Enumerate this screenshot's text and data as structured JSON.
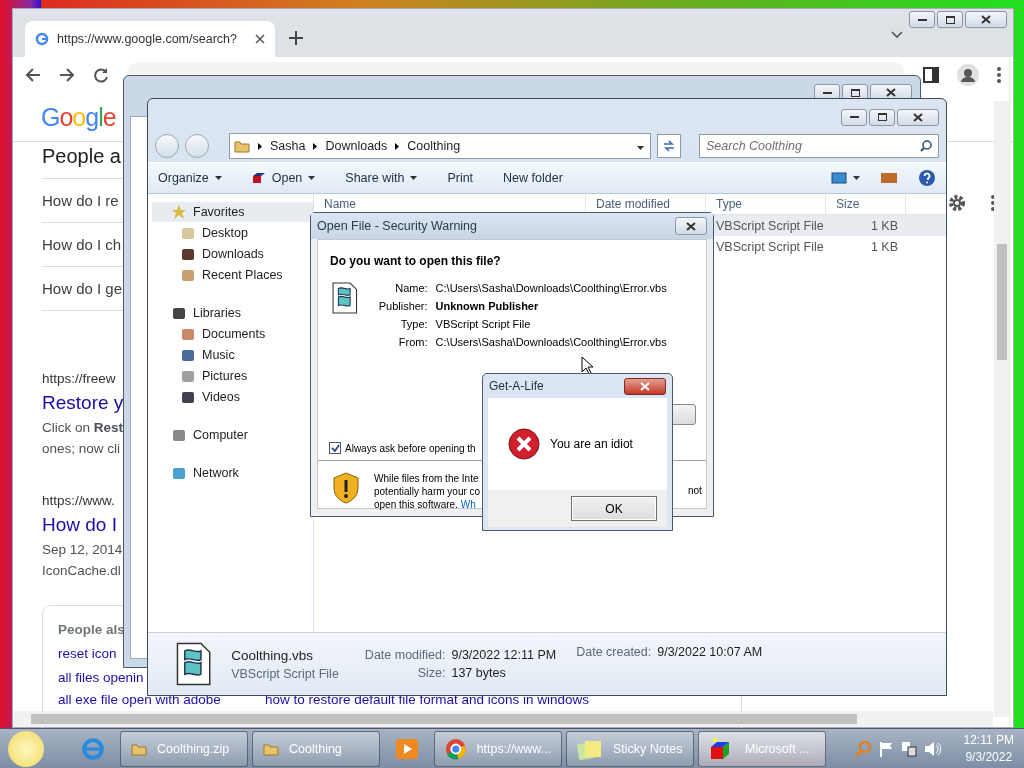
{
  "browser": {
    "tab": {
      "title": "https://www.google.com/search?"
    },
    "page": {
      "logo": "Google",
      "people_also_ask": {
        "heading": "People a",
        "questions": [
          "How do I re",
          "How do I ch",
          "How do I ge"
        ]
      },
      "results": [
        {
          "url": "https://freew",
          "title": "Restore y",
          "snippet": [
            "Click on **Rest**",
            "ones; now cli"
          ]
        },
        {
          "url": "https://www.",
          "title": "How do I",
          "snippet": [
            "Sep 12, 2014",
            "IconCache.dl"
          ]
        }
      ],
      "related": {
        "heading": "People als",
        "items": [
          "reset icon",
          "all files openin"
        ],
        "last_row": [
          "all exe file open with adobe",
          "how to restore default file format and icons in windows"
        ]
      }
    }
  },
  "explorer": {
    "breadcrumb": [
      "Sasha",
      "Downloads",
      "Coolthing"
    ],
    "search": {
      "placeholder": "Search Coolthing"
    },
    "toolbar": [
      {
        "label": "Organize",
        "dropdown": true
      },
      {
        "label": "Open",
        "dropdown": true
      },
      {
        "label": "Share with",
        "dropdown": true
      },
      {
        "label": "Print",
        "dropdown": false
      },
      {
        "label": "New folder",
        "dropdown": false
      }
    ],
    "nav": [
      {
        "label": "Favorites",
        "selected": true,
        "children": [
          {
            "label": "Desktop"
          },
          {
            "label": "Downloads"
          },
          {
            "label": "Recent Places"
          }
        ]
      },
      {
        "label": "Libraries",
        "selected": false,
        "children": [
          {
            "label": "Documents"
          },
          {
            "label": "Music"
          },
          {
            "label": "Pictures"
          },
          {
            "label": "Videos"
          }
        ]
      },
      {
        "label": "Computer",
        "selected": false
      },
      {
        "label": "Network",
        "selected": false
      }
    ],
    "columns": [
      "Name",
      "Date modified",
      "Type",
      "Size"
    ],
    "rows": [
      {
        "type": "VBScript Script File",
        "size": "1 KB",
        "selected": true
      },
      {
        "type": "VBScript Script File",
        "size": "1 KB",
        "selected": false
      }
    ],
    "details": {
      "name": "Coolthing.vbs",
      "type": "VBScript Script File",
      "modified_label": "Date modified:",
      "modified": "9/3/2022 12:11 PM",
      "size_label": "Size:",
      "size": "137 bytes",
      "created_label": "Date created:",
      "created": "9/3/2022 10:07 AM"
    }
  },
  "security_dialog": {
    "title": "Open File - Security Warning",
    "question": "Do you want to open this file?",
    "fields": [
      {
        "label": "Name:",
        "value": "C:\\Users\\Sasha\\Downloads\\Coolthing\\Error.vbs",
        "bold": false
      },
      {
        "label": "Publisher:",
        "value": "Unknown Publisher",
        "bold": true
      },
      {
        "label": "Type:",
        "value": "VBScript Script File",
        "bold": false
      },
      {
        "label": "From:",
        "value": "C:\\Users\\Sasha\\Downloads\\Coolthing\\Error.vbs",
        "bold": false
      }
    ],
    "checkbox": {
      "label": "Always ask before opening th",
      "checked": true
    },
    "warning": {
      "lines": [
        "While files from the Inte",
        "potentially harm your co"
      ],
      "last_line": "open this software.",
      "link": "Wh",
      "tail": "not"
    }
  },
  "message_box": {
    "title": "Get-A-Life",
    "message": "You are an idiot",
    "button": "OK"
  },
  "taskbar": {
    "items": [
      {
        "kind": "icon",
        "selected": false
      },
      {
        "kind": "button",
        "label": "Coolthing.zip",
        "selected": false
      },
      {
        "kind": "button",
        "label": "Coolthing",
        "selected": false
      },
      {
        "kind": "icon",
        "selected": false
      },
      {
        "kind": "button",
        "label": "https://www...",
        "selected": false
      },
      {
        "kind": "button",
        "label": "Sticky Notes",
        "selected": false
      },
      {
        "kind": "button",
        "label": "Microsoft ...",
        "selected": true
      }
    ],
    "time": "12:11 PM",
    "date": "9/3/2022"
  }
}
